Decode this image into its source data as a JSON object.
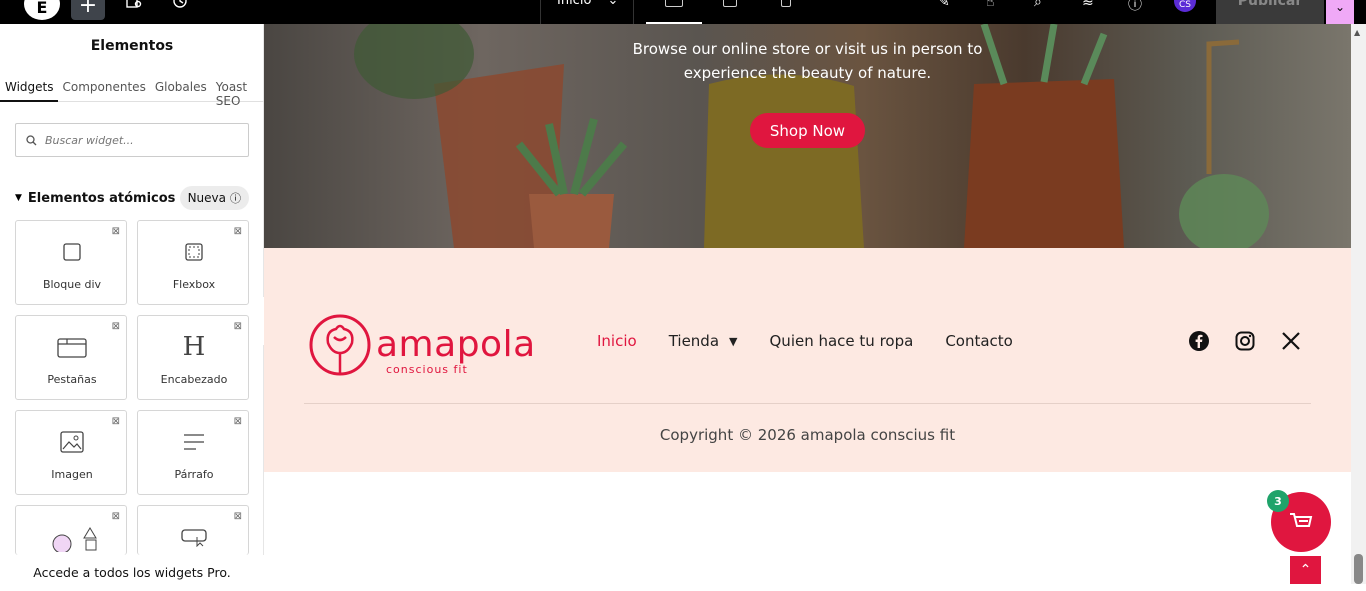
{
  "topbar": {
    "logo": "E",
    "add": "+",
    "page_select": "Inicio",
    "publish": "Publicar",
    "avatar": "CS"
  },
  "sidebar": {
    "title": "Elementos",
    "tabs": [
      "Widgets",
      "Componentes",
      "Globales",
      "Yoast SEO"
    ],
    "search_placeholder": "Buscar widget...",
    "category": "Elementos atómicos",
    "badge": "Nueva",
    "widgets": [
      {
        "label": "Bloque div",
        "icon": "div-block-icon"
      },
      {
        "label": "Flexbox",
        "icon": "flexbox-icon"
      },
      {
        "label": "Pestañas",
        "icon": "tabs-icon"
      },
      {
        "label": "Encabezado",
        "icon": "heading-icon"
      },
      {
        "label": "Imagen",
        "icon": "image-icon"
      },
      {
        "label": "Párrafo",
        "icon": "paragraph-icon"
      },
      {
        "label": "",
        "icon": "shapes-icon"
      },
      {
        "label": "",
        "icon": "button-icon"
      }
    ],
    "pro_text": "Accede a todos los widgets Pro."
  },
  "hero": {
    "line1": "Browse our online store or visit us in person to",
    "line2": "experience the beauty of nature.",
    "button": "Shop Now"
  },
  "footer": {
    "brand": "amapola",
    "brand_sub": "conscious fit",
    "nav": [
      "Inicio",
      "Tienda",
      "Quien hace tu ropa",
      "Contacto"
    ],
    "copyright": "Copyright © 2026 amapola conscius fit"
  },
  "cart": {
    "count": "3"
  },
  "colors": {
    "accent": "#e0163f",
    "footer_bg": "#fde9e2",
    "badge": "#1fa36a"
  }
}
